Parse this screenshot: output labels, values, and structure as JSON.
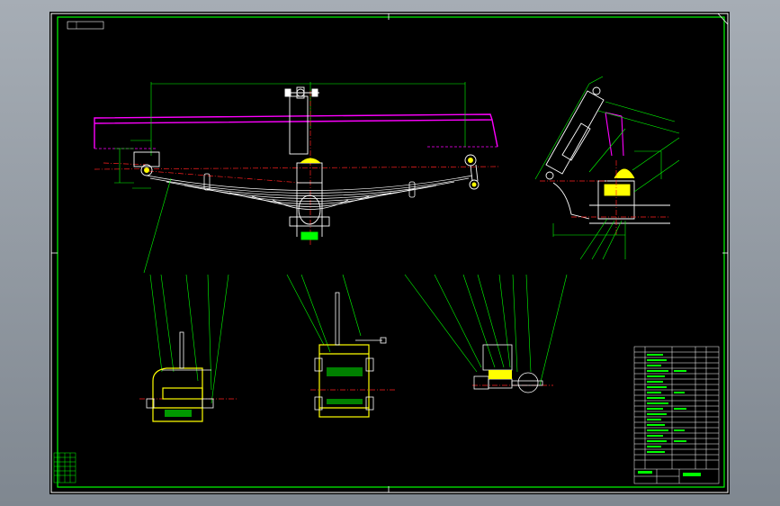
{
  "drawing": {
    "title": "",
    "colors": {
      "background": "#000000",
      "frame": "#00ff00",
      "part_outline": "#ffffff",
      "highlight": "#ffff00",
      "centerline": "#ff2020",
      "frame_rail": "#ff00ff",
      "dimension": "#00ff00",
      "section_fill": "#ffffff"
    }
  },
  "views": [
    {
      "id": "main-view-leaf-spring-assembly"
    },
    {
      "id": "side-view-shock-absorber"
    },
    {
      "id": "section-view-front-hanger"
    },
    {
      "id": "section-view-u-bolt-clamp"
    },
    {
      "id": "section-view-shackle-pin"
    }
  ],
  "title_block": {
    "rows": 22,
    "columns": 4
  }
}
